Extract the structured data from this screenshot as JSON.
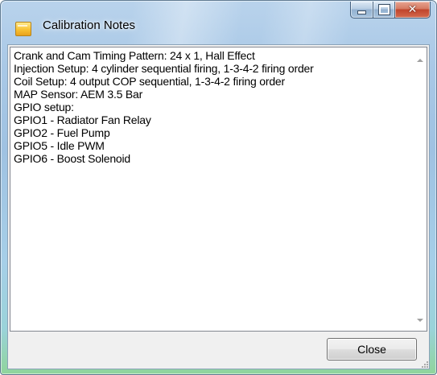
{
  "window": {
    "title": "Calibration Notes"
  },
  "notes": {
    "lines": [
      "Crank and Cam Timing Pattern: 24 x 1, Hall Effect",
      "Injection Setup: 4 cylinder sequential firing, 1-3-4-2 firing order",
      "Coil Setup: 4 output COP sequential, 1-3-4-2 firing order",
      "MAP Sensor: AEM 3.5 Bar",
      "GPIO setup:",
      "GPIO1 - Radiator Fan Relay",
      "GPIO2 - Fuel Pump",
      "GPIO5 - Idle PWM",
      "GPIO6 - Boost Solenoid"
    ]
  },
  "buttons": {
    "close_label": "Close"
  },
  "icons": {
    "app": "notes-app-icon",
    "minimize": "minimize-icon",
    "maximize": "maximize-icon",
    "close": "close-icon",
    "scroll_up": "scroll-up-arrow-icon",
    "scroll_down": "scroll-down-arrow-icon",
    "resize": "resize-grip-icon"
  }
}
